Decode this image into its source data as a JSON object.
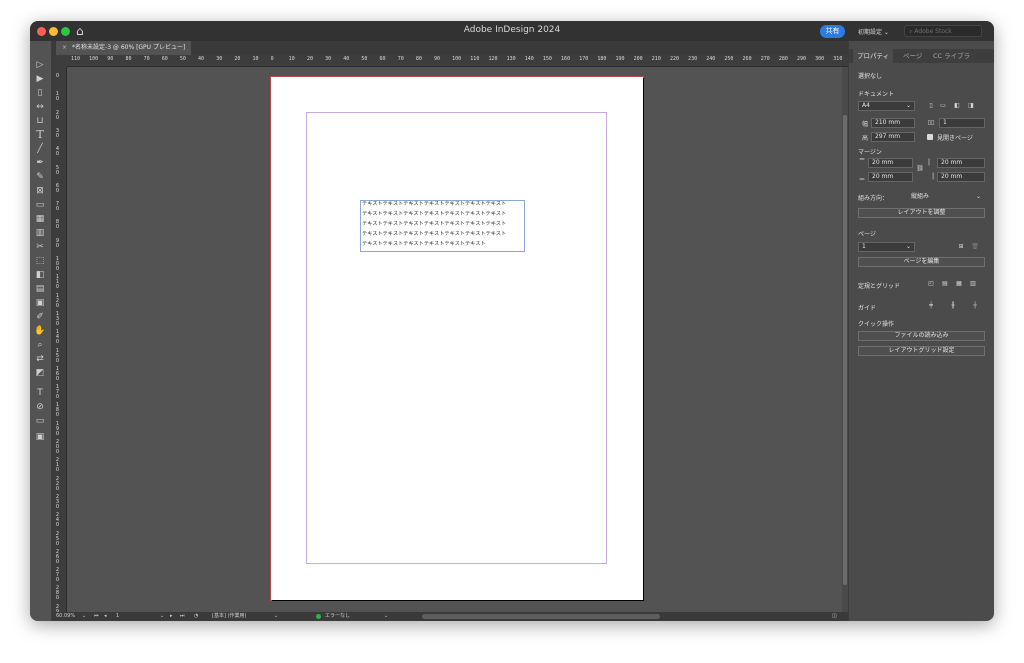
{
  "app": {
    "title": "Adobe InDesign 2024",
    "share_label": "共有",
    "preset_label": "初期設定 ⌄",
    "stock_placeholder": "Adobe Stock"
  },
  "document_tab": {
    "close": "×",
    "label": "*名称未設定-3 @ 60% [GPU プレビュー]"
  },
  "ruler": {
    "h_ticks": [
      "110",
      "100",
      "90",
      "80",
      "70",
      "60",
      "50",
      "40",
      "30",
      "20",
      "10",
      "0",
      "10",
      "20",
      "30",
      "40",
      "50",
      "60",
      "70",
      "80",
      "90",
      "100",
      "110",
      "120",
      "130",
      "140",
      "150",
      "160",
      "170",
      "180",
      "190",
      "200",
      "210",
      "220",
      "230",
      "240",
      "250",
      "260",
      "270",
      "280",
      "290",
      "300",
      "310",
      "32"
    ],
    "v_ticks": [
      "0",
      "10",
      "20",
      "30",
      "40",
      "50",
      "60",
      "70",
      "80",
      "90",
      "100",
      "110",
      "120",
      "130",
      "140",
      "150",
      "160",
      "170",
      "180",
      "190",
      "200",
      "210",
      "220",
      "230",
      "240",
      "250",
      "260",
      "270",
      "280",
      "290"
    ]
  },
  "text_frame": {
    "lines": [
      "テキストテキストテキストテキストテキストテキストテキスト",
      "テキストテキストテキストテキストテキストテキストテキスト",
      "テキストテキストテキストテキストテキストテキストテキスト",
      "テキストテキストテキストテキストテキストテキストテキスト",
      "テキストテキストテキストテキストテキストテキスト"
    ]
  },
  "status": {
    "zoom": "60.09%",
    "page": "1",
    "style": "[基本] (作業用)",
    "preflight": "エラーなし"
  },
  "panel": {
    "tabs": [
      "プロパティ",
      "ページ",
      "CC ライブラ"
    ],
    "selection": "選択なし",
    "document_header": "ドキュメント",
    "page_size": "A4",
    "width_label": "幅",
    "width_value": "210 mm",
    "height_label": "高",
    "height_value": "297 mm",
    "pages_value": "1",
    "facing_pages": "見開きページ",
    "margin_header": "マージン",
    "margin_top": "20 mm",
    "margin_bottom": "20 mm",
    "margin_inside": "20 mm",
    "margin_outside": "20 mm",
    "direction_label": "組み方向：",
    "direction_value": "縦組み",
    "adjust_layout": "レイアウトを調整",
    "page_header": "ページ",
    "page_value": "1",
    "edit_page": "ページを編集",
    "rulers_grids": "定規とグリッド",
    "guides": "ガイド",
    "quick_actions": "クイック操作",
    "import_file": "ファイルの読み込み",
    "layout_grid": "レイアウトグリッド設定"
  },
  "colors": {
    "accent": "#2d7be5",
    "page_bleed": "#b8484f",
    "margin_guide": "#c6a9e0",
    "frame": "#8aa7d8"
  }
}
